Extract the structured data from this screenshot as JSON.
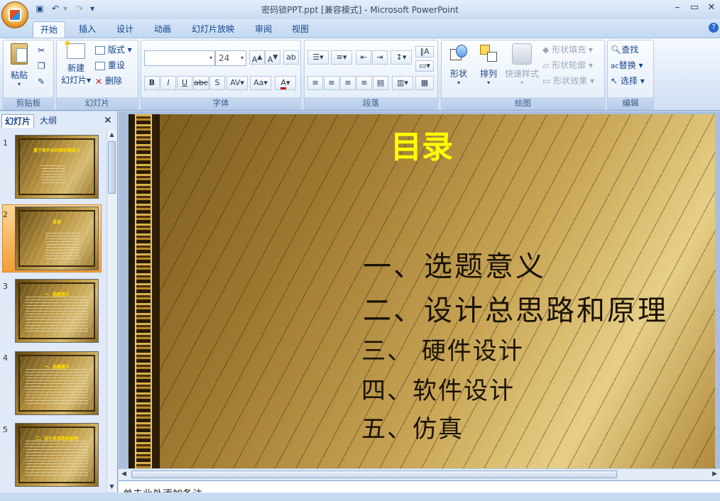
{
  "window": {
    "title": "密码锁PPT.ppt [兼容模式] - Microsoft PowerPoint"
  },
  "tabs": [
    {
      "label": "开始",
      "active": true
    },
    {
      "label": "插入"
    },
    {
      "label": "设计"
    },
    {
      "label": "动画"
    },
    {
      "label": "幻灯片放映"
    },
    {
      "label": "审阅"
    },
    {
      "label": "视图"
    }
  ],
  "ribbon": {
    "clipboard": {
      "paste": "粘贴",
      "label": "剪贴板"
    },
    "slides": {
      "new_slide_line1": "新建",
      "new_slide_line2": "幻灯片",
      "layout": "版式",
      "reset": "重设",
      "delete": "删除",
      "label": "幻灯片"
    },
    "font": {
      "size": "24",
      "label": "字体"
    },
    "paragraph": {
      "label": "段落"
    },
    "drawing": {
      "shapes": "形状",
      "arrange": "排列",
      "quick_styles": "快速样式",
      "fill": "形状填充",
      "outline": "形状轮廓",
      "effects": "形状效果",
      "label": "绘图"
    },
    "editing": {
      "find": "查找",
      "replace": "替换",
      "select": "选择",
      "label": "编辑"
    }
  },
  "panel": {
    "tab_slides": "幻灯片",
    "tab_outline": "大纲",
    "thumbnails": [
      {
        "number": "1",
        "title": "基于单片机的密码锁设计"
      },
      {
        "number": "2",
        "title": "目录",
        "selected": true
      },
      {
        "number": "3",
        "title": "一、选题意义"
      },
      {
        "number": "4",
        "title": "一、选题意义"
      },
      {
        "number": "5",
        "title": "二、设计总思路和原理"
      }
    ]
  },
  "slide": {
    "title": "目录",
    "items": [
      "一、选题意义",
      "二、设计总思路和原理",
      "三、 硬件设计",
      "四、软件设计",
      "五、仿真"
    ]
  },
  "notes": {
    "text": "单击此处添加备注"
  },
  "colors": {
    "title_yellow": "#ffff00",
    "ribbon_blue": "#15428b",
    "selection_orange": "#f29d38"
  }
}
